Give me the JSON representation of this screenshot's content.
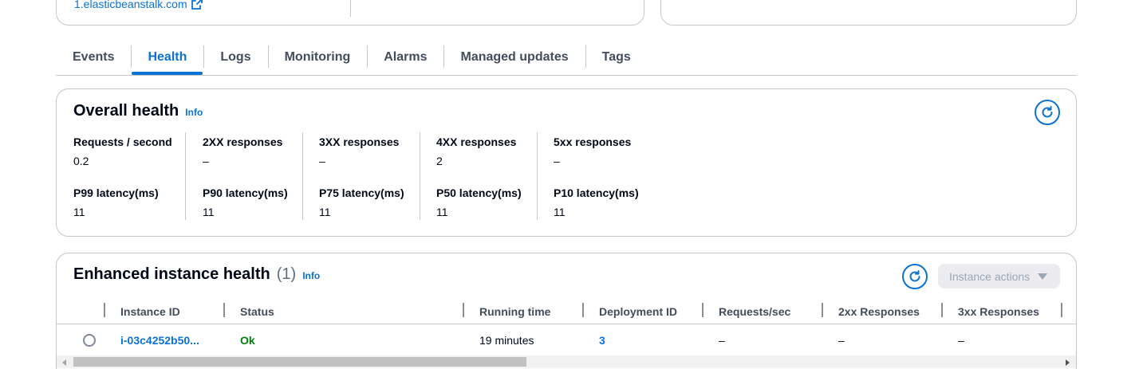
{
  "top": {
    "link_text": "1.elasticbeanstalk.com"
  },
  "tabs": [
    {
      "label": "Events",
      "active": false
    },
    {
      "label": "Health",
      "active": true
    },
    {
      "label": "Logs",
      "active": false
    },
    {
      "label": "Monitoring",
      "active": false
    },
    {
      "label": "Alarms",
      "active": false
    },
    {
      "label": "Managed updates",
      "active": false
    },
    {
      "label": "Tags",
      "active": false
    }
  ],
  "overall": {
    "title": "Overall health",
    "info": "Info",
    "refresh_icon": "refresh-icon",
    "row1": [
      {
        "label": "Requests / second",
        "value": "0.2"
      },
      {
        "label": "2XX responses",
        "value": "–"
      },
      {
        "label": "3XX responses",
        "value": "–"
      },
      {
        "label": "4XX responses",
        "value": "2"
      },
      {
        "label": "5xx responses",
        "value": "–"
      }
    ],
    "row2": [
      {
        "label": "P99 latency(ms)",
        "value": "11"
      },
      {
        "label": "P90 latency(ms)",
        "value": "11"
      },
      {
        "label": "P75 latency(ms)",
        "value": "11"
      },
      {
        "label": "P50 latency(ms)",
        "value": "11"
      },
      {
        "label": "P10 latency(ms)",
        "value": "11"
      }
    ]
  },
  "enhanced": {
    "title": "Enhanced instance health",
    "count": "(1)",
    "info": "Info",
    "actions_label": "Instance actions",
    "columns": [
      "Instance ID",
      "Status",
      "Running time",
      "Deployment ID",
      "Requests/sec",
      "2xx Responses",
      "3xx Responses"
    ],
    "rows": [
      {
        "instance_id": "i-03c4252b50...",
        "status": "Ok",
        "running_time": "19 minutes",
        "deployment_id": "3",
        "requests_sec": "–",
        "resp_2xx": "–",
        "resp_3xx": "–"
      }
    ]
  },
  "colors": {
    "accent": "#0972d3",
    "ok": "#037f0c",
    "border": "#c6c6cd",
    "disabled_bg": "#ebebf0"
  }
}
